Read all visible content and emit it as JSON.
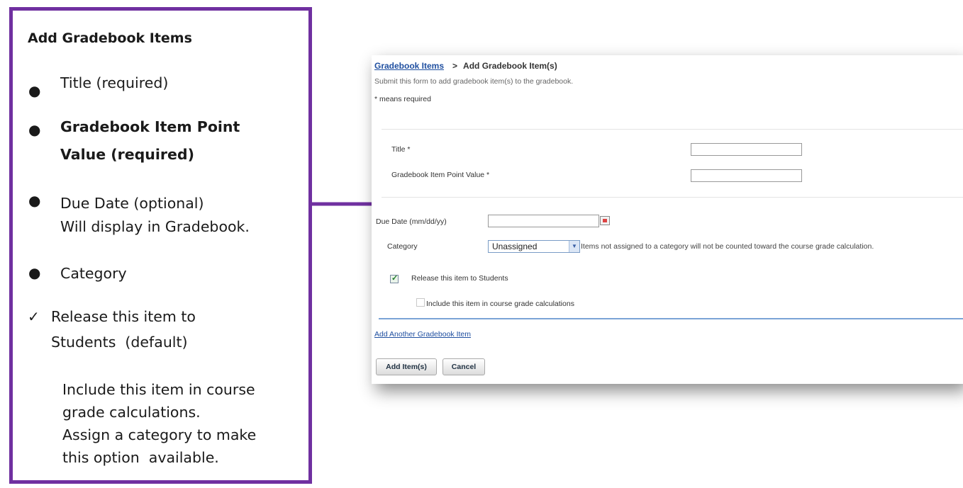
{
  "annotation": {
    "heading": "Add Gradebook Items",
    "bullets": [
      {
        "lines": [
          "Title (required)"
        ]
      },
      {
        "lines": [
          "Gradebook Item Point",
          "Value (required)"
        ]
      },
      {
        "lines": [
          "Due Date (optional)",
          "Will display in Gradebook."
        ]
      },
      {
        "lines": [
          "Category"
        ]
      }
    ],
    "release": {
      "check": "✓",
      "lines": [
        "Release this item to",
        "Students  (default)"
      ]
    },
    "include_note": [
      "Include this item in course",
      "grade calculations.",
      "Assign a category to make",
      "this option  available."
    ]
  },
  "form": {
    "breadcrumb": {
      "link": "Gradebook Items",
      "separator": ">",
      "current": "Add Gradebook Item(s)"
    },
    "description": "Submit this form to add gradebook item(s) to the gradebook.",
    "required_note": "* means required",
    "title_label": "Title *",
    "title_value": "",
    "points_label": "Gradebook Item Point Value *",
    "points_value": "",
    "due_label": "Due Date (mm/dd/yy)",
    "due_value": "",
    "category_label": "Category",
    "category_value": "Unassigned",
    "category_note": "Items not assigned to a category will not be counted toward the course grade calculation.",
    "release_label": "Release this item to Students",
    "release_checked": true,
    "include_label": "Include this item in course grade calculations",
    "include_checked": false,
    "add_another": "Add Another Gradebook Item",
    "add_button": "Add Item(s)",
    "cancel_button": "Cancel"
  },
  "colors": {
    "frame": "#7030a0",
    "arrow": "#7030a0",
    "link": "#1f4fa0",
    "divider": "#7aa3d6"
  }
}
